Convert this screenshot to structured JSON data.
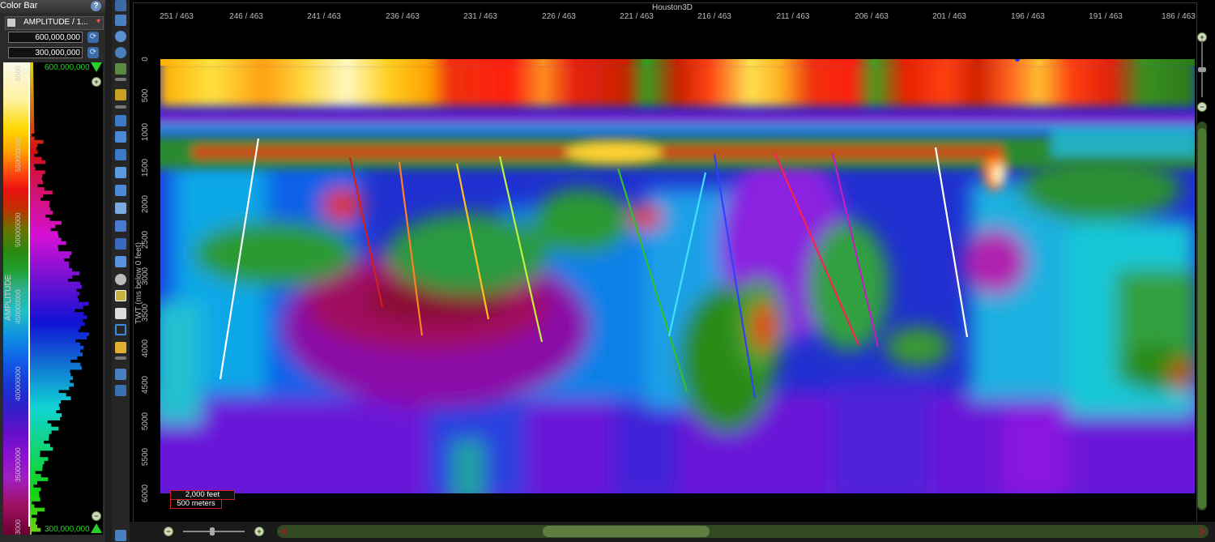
{
  "color_bar": {
    "title": "Color Bar",
    "help_icon": "?",
    "attribute_select": "AMPLITUDE / 1...",
    "max_input": "600,000,000",
    "min_input": "300,000,000",
    "top_value": "600,000,000",
    "bottom_value": "300,000,000",
    "axis_label": "AMPLITUDE",
    "ticks": [
      "6000",
      "550000000",
      "500000000",
      "450000000",
      "400000000",
      "350000000",
      "3000"
    ]
  },
  "view": {
    "title": "Houston3D",
    "x_ticks": [
      "251 / 463",
      "246 / 463",
      "241 / 463",
      "236 / 463",
      "231 / 463",
      "226 / 463",
      "221 / 463",
      "216 / 463",
      "211 / 463",
      "206 / 463",
      "201 / 463",
      "196 / 463",
      "191 / 463",
      "186 / 463"
    ],
    "y_ticks": [
      "0",
      "500",
      "1000",
      "1500",
      "2000",
      "2500",
      "3000",
      "3500",
      "4000",
      "4500",
      "5000",
      "5500",
      "6000"
    ],
    "y_axis_label": "TWT (ms below 0 feet)",
    "scale_feet": "2,000 feet",
    "scale_meters": "500 meters"
  },
  "faults": [
    {
      "color": "#ffffff"
    },
    {
      "color": "#d02020"
    },
    {
      "color": "#ff8020"
    },
    {
      "color": "#ffc020"
    },
    {
      "color": "#c0f040"
    },
    {
      "color": "#30c030"
    },
    {
      "color": "#40e0ff"
    },
    {
      "color": "#3040ff"
    },
    {
      "color": "#ff2050"
    },
    {
      "color": "#c020c0"
    },
    {
      "color": "#ffffff"
    }
  ],
  "icons": {
    "help": "help-icon",
    "refresh": "refresh-icon",
    "zoom_in": "zoom-in-icon",
    "zoom_out": "zoom-out-icon"
  }
}
